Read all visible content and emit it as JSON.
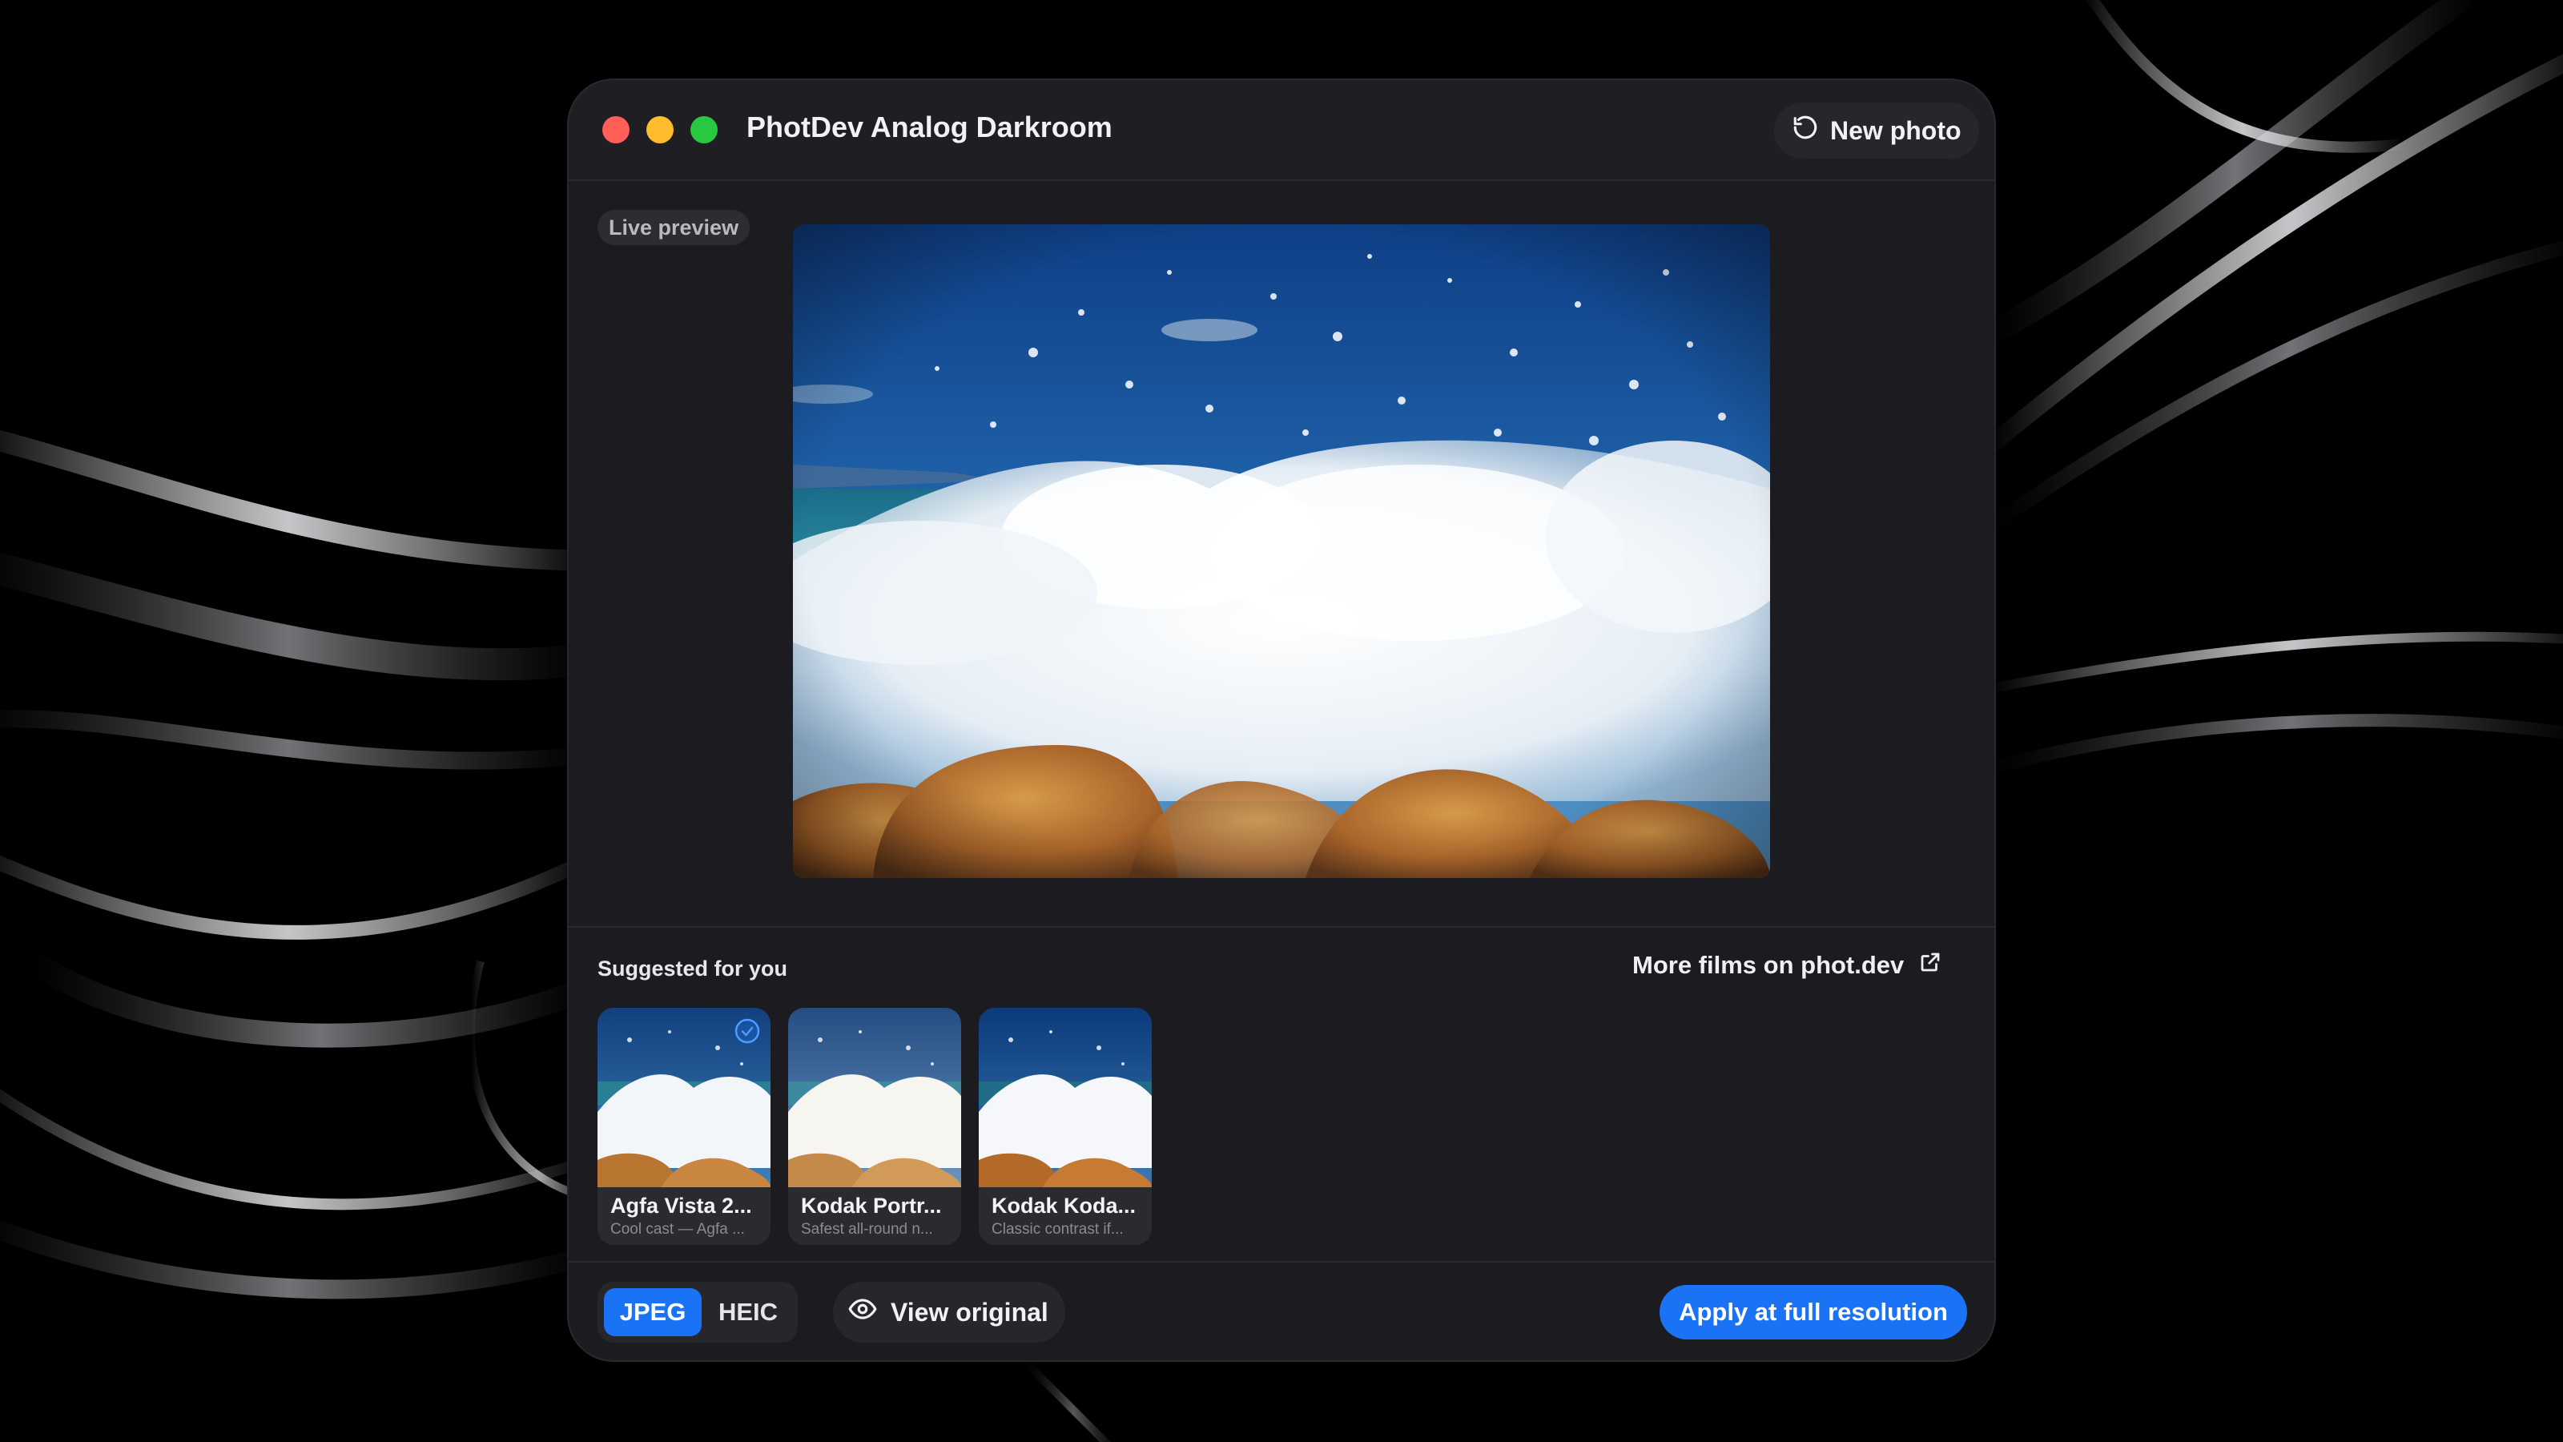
{
  "window": {
    "title": "PhotDev Analog Darkroom",
    "new_photo_label": "New photo"
  },
  "preview": {
    "badge": "Live preview"
  },
  "suggestions": {
    "heading": "Suggested for you",
    "more_link": "More films on phot.dev",
    "films": [
      {
        "name": "Agfa Vista 2...",
        "description": "Cool cast — Agfa ...",
        "selected": true
      },
      {
        "name": "Kodak Portr...",
        "description": "Safest all-round n...",
        "selected": false
      },
      {
        "name": "Kodak Koda...",
        "description": "Classic contrast if...",
        "selected": false
      }
    ]
  },
  "footer": {
    "formats": [
      "JPEG",
      "HEIC"
    ],
    "selected_format": "JPEG",
    "view_original_label": "View original",
    "apply_label": "Apply at full resolution"
  },
  "colors": {
    "accent": "#1a73f5",
    "close": "#ff5f57",
    "minimize": "#febc2e",
    "zoom": "#28c840"
  }
}
